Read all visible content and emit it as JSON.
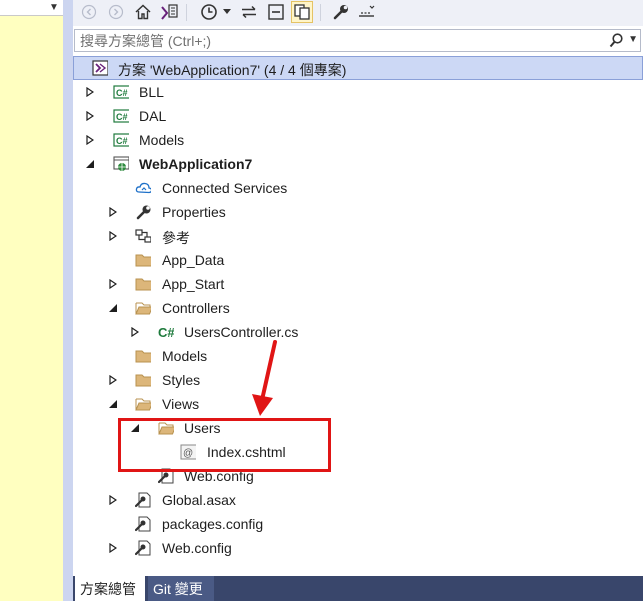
{
  "search": {
    "placeholder": "搜尋方案總管 (Ctrl+;)"
  },
  "solution": {
    "label": "方案 'WebApplication7' (4 / 4 個專案)"
  },
  "tree": [
    {
      "label": "BLL",
      "icon": "csharp-project-icon"
    },
    {
      "label": "DAL",
      "icon": "csharp-project-icon"
    },
    {
      "label": "Models",
      "icon": "csharp-project-icon"
    },
    {
      "label": "WebApplication7",
      "icon": "web-project-icon"
    },
    {
      "label": "Connected Services",
      "icon": "connected-services-icon"
    },
    {
      "label": "Properties",
      "icon": "wrench-icon"
    },
    {
      "label": "參考",
      "icon": "references-icon"
    },
    {
      "label": "App_Data",
      "icon": "folder-icon"
    },
    {
      "label": "App_Start",
      "icon": "folder-icon"
    },
    {
      "label": "Controllers",
      "icon": "folder-open-icon"
    },
    {
      "label": "UsersController.cs",
      "icon": "csharp-file-icon"
    },
    {
      "label": "Models",
      "icon": "folder-icon"
    },
    {
      "label": "Styles",
      "icon": "folder-icon"
    },
    {
      "label": "Views",
      "icon": "folder-open-icon"
    },
    {
      "label": "Users",
      "icon": "folder-open-icon"
    },
    {
      "label": "Index.cshtml",
      "icon": "razor-file-icon"
    },
    {
      "label": "Web.config",
      "icon": "config-file-icon"
    },
    {
      "label": "Global.asax",
      "icon": "config-file-icon"
    },
    {
      "label": "packages.config",
      "icon": "config-file-icon"
    },
    {
      "label": "Web.config",
      "icon": "config-file-icon"
    }
  ],
  "tabs": {
    "solution_explorer": "方案總管",
    "git_changes": "Git 變更"
  },
  "colors": {
    "accent": "#39466b",
    "highlight": "#e01515",
    "selected": "#ccd8f5",
    "left_pane": "#ffffc0"
  }
}
